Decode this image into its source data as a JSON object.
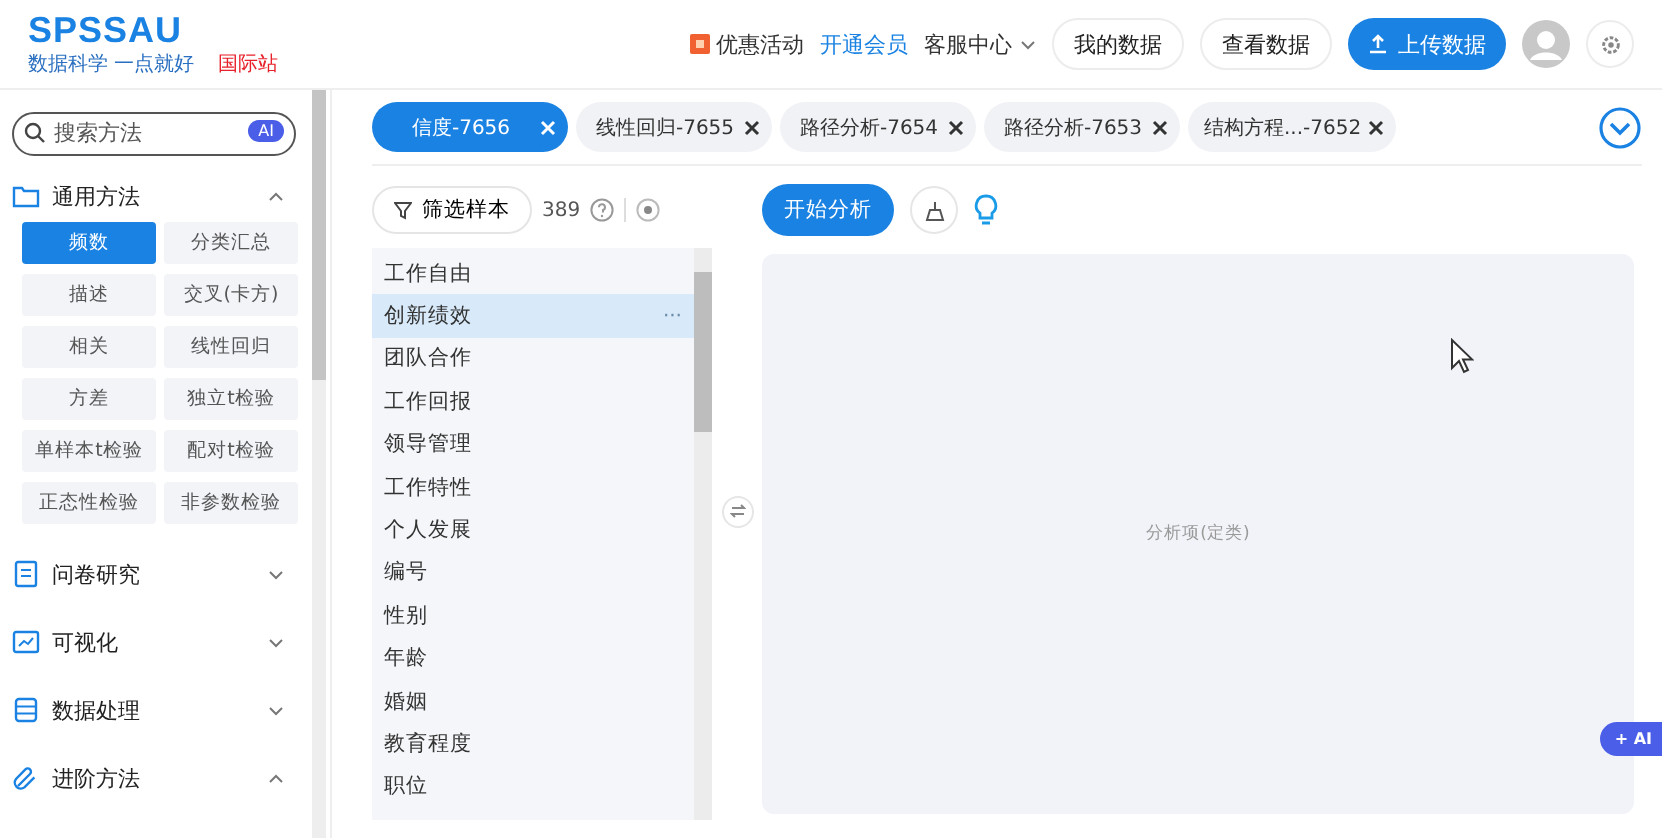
{
  "header": {
    "logo": "SPSSAU",
    "slogan": "数据科学 一点就好",
    "intl_link": "国际站",
    "promo": "优惠活动",
    "membership": "开通会员",
    "support": "客服中心",
    "my_data": "我的数据",
    "view_data": "查看数据",
    "upload": "上传数据"
  },
  "sidebar": {
    "search": {
      "placeholder": "搜索方法",
      "badge": "AI"
    },
    "sections": [
      {
        "kind": "folder",
        "label": "通用方法",
        "expanded": true,
        "methods": [
          {
            "label": "频数",
            "selected": true
          },
          {
            "label": "分类汇总",
            "selected": false
          },
          {
            "label": "描述",
            "selected": false
          },
          {
            "label": "交叉(卡方)",
            "selected": false
          },
          {
            "label": "相关",
            "selected": false
          },
          {
            "label": "线性回归",
            "selected": false
          },
          {
            "label": "方差",
            "selected": false
          },
          {
            "label": "独立t检验",
            "selected": false
          },
          {
            "label": "单样本t检验",
            "selected": false
          },
          {
            "label": "配对t检验",
            "selected": false
          },
          {
            "label": "正态性检验",
            "selected": false
          },
          {
            "label": "非参数检验",
            "selected": false
          }
        ]
      },
      {
        "kind": "survey",
        "label": "问卷研究",
        "expanded": false
      },
      {
        "kind": "chart",
        "label": "可视化",
        "expanded": false
      },
      {
        "kind": "data",
        "label": "数据处理",
        "expanded": false
      },
      {
        "kind": "link",
        "label": "进阶方法",
        "expanded": true
      }
    ]
  },
  "tabs": [
    {
      "label": "信度-7656",
      "selected": true
    },
    {
      "label": "线性回归-7655",
      "selected": false
    },
    {
      "label": "路径分析-7654",
      "selected": false
    },
    {
      "label": "路径分析-7653",
      "selected": false
    },
    {
      "label": "结构方程...-7652",
      "selected": false
    }
  ],
  "filter": {
    "button": "筛选样本",
    "count": "389"
  },
  "variables": [
    {
      "label": "工作自由",
      "selected": false
    },
    {
      "label": "创新绩效",
      "selected": true
    },
    {
      "label": "团队合作",
      "selected": false
    },
    {
      "label": "工作回报",
      "selected": false
    },
    {
      "label": "领导管理",
      "selected": false
    },
    {
      "label": "工作特性",
      "selected": false
    },
    {
      "label": "个人发展",
      "selected": false
    },
    {
      "label": "编号",
      "selected": false
    },
    {
      "label": "性别",
      "selected": false
    },
    {
      "label": "年龄",
      "selected": false
    },
    {
      "label": "婚姻",
      "selected": false
    },
    {
      "label": "教育程度",
      "selected": false
    },
    {
      "label": "职位",
      "selected": false
    }
  ],
  "selected_more": "···",
  "analysis": {
    "start": "开始分析",
    "drop_zone": "分析项(定类)",
    "ai_badge": "+ AI"
  }
}
